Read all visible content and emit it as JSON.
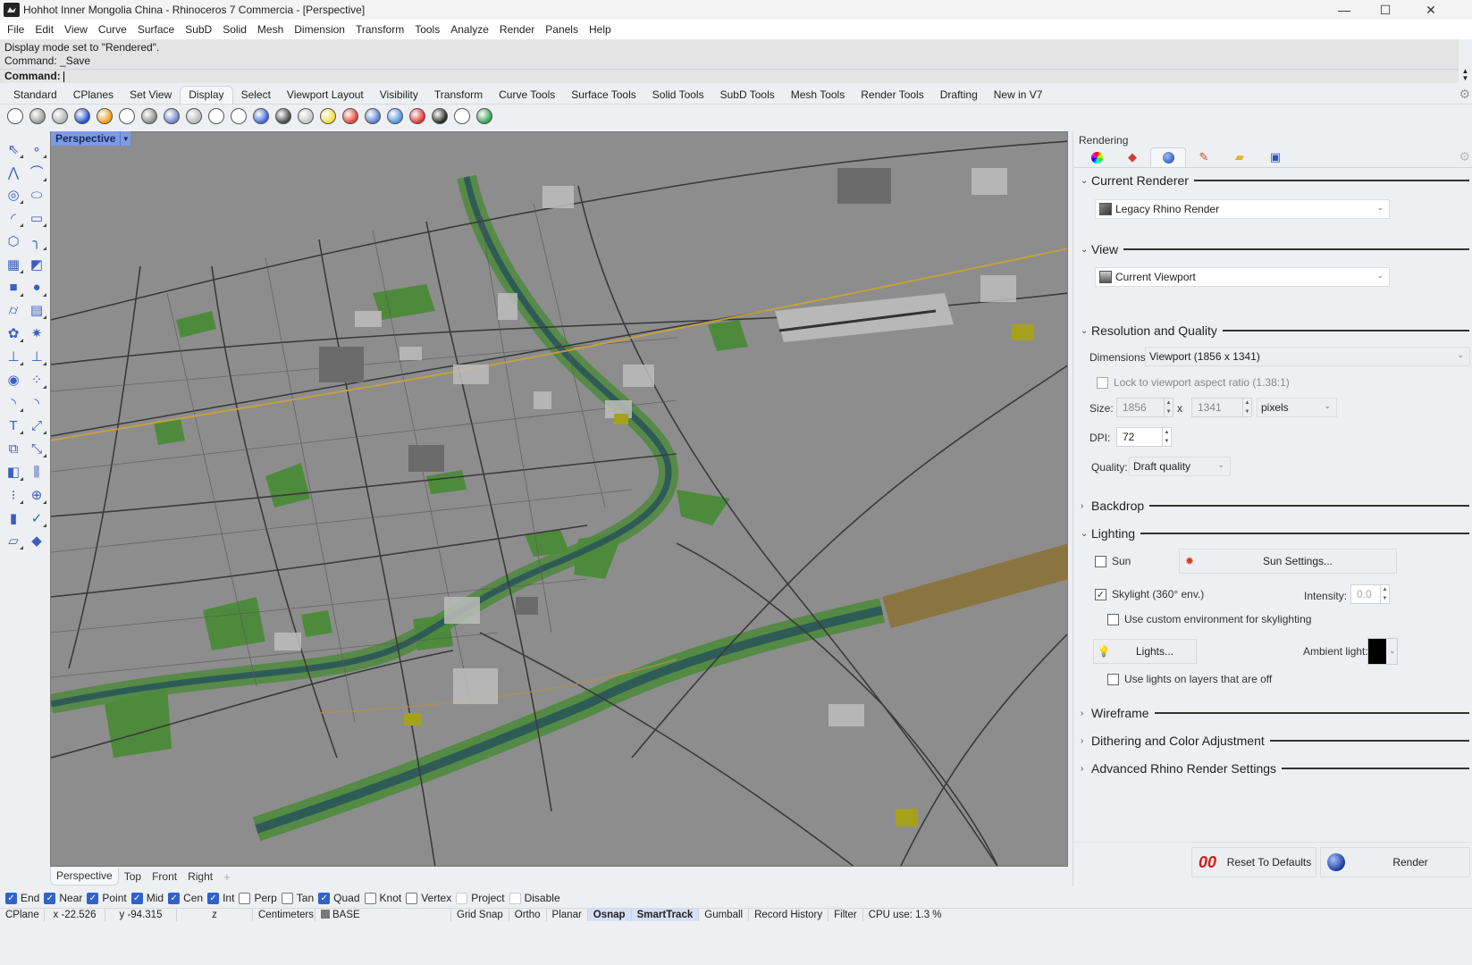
{
  "window": {
    "title": "Hohhot Inner Mongolia China - Rhinoceros 7 Commercia - [Perspective]",
    "controls": {
      "minimize": "—",
      "maximize": "☐",
      "close": "✕"
    }
  },
  "menu": [
    "File",
    "Edit",
    "View",
    "Curve",
    "Surface",
    "SubD",
    "Solid",
    "Mesh",
    "Dimension",
    "Transform",
    "Tools",
    "Analyze",
    "Render",
    "Panels",
    "Help"
  ],
  "command": {
    "history": [
      "Display mode set to \"Rendered\".",
      "Command: _Save"
    ],
    "prompt": "Command:",
    "value": ""
  },
  "toolbar_tabs": {
    "items": [
      "Standard",
      "CPlanes",
      "Set View",
      "Display",
      "Select",
      "Viewport Layout",
      "Visibility",
      "Transform",
      "Curve Tools",
      "Surface Tools",
      "Solid Tools",
      "SubD Tools",
      "Mesh Tools",
      "Render Tools",
      "Drafting",
      "New in V7"
    ],
    "active": "Display"
  },
  "display_icons": [
    {
      "name": "wireframe-icon",
      "color": "#ffffff"
    },
    {
      "name": "shaded-icon",
      "color": "#9a9a9a"
    },
    {
      "name": "rendered-icon",
      "color": "#b0b0b0"
    },
    {
      "name": "ghosted-icon",
      "color": "#1f4fd0"
    },
    {
      "name": "xray-icon",
      "color": "#f39a12"
    },
    {
      "name": "technical-icon",
      "color": "#ffffff"
    },
    {
      "name": "artistic-icon",
      "color": "#8a8a8a"
    },
    {
      "name": "pen-icon",
      "color": "#6d83c8"
    },
    {
      "name": "arctic-icon",
      "color": "#b8b8b8"
    },
    {
      "name": "monochrome-icon",
      "color": "#ffffff"
    },
    {
      "name": "raytraced-icon",
      "color": "#ffffff"
    },
    {
      "name": "show-edges-icon",
      "color": "#3a66d8"
    },
    {
      "name": "show-mesh-icon",
      "color": "#444444"
    },
    {
      "name": "isocurves-icon",
      "color": "#c4c4c4"
    },
    {
      "name": "lights-icon",
      "color": "#f0dc3a"
    },
    {
      "name": "cplane-icon",
      "color": "#e04030"
    },
    {
      "name": "camera-icon",
      "color": "#5a7ad0"
    },
    {
      "name": "screen-icon",
      "color": "#5090e0"
    },
    {
      "name": "hide-icon",
      "color": "#e03030"
    },
    {
      "name": "monitor-icon",
      "color": "#222222"
    },
    {
      "name": "boxes-icon",
      "color": "#ffffff"
    },
    {
      "name": "color-cube-icon",
      "color": "#30a050"
    }
  ],
  "left_tools": [
    "select-arrow-icon",
    "point-icon",
    "polyline-icon",
    "curve-icon",
    "circle-icon",
    "ellipse-icon",
    "arc-icon",
    "rectangle-icon",
    "polygon-icon",
    "fillet-curve-icon",
    "surface-from-points-icon",
    "extrude-surface-icon",
    "box-icon",
    "sphere-icon",
    "cylinder-icon",
    "mesh-surface-icon",
    "boolean-icon",
    "explode-icon",
    "trim-icon",
    "split-icon",
    "group-icon",
    "points-on-icon",
    "fillet-icon",
    "chamfer-icon",
    "text-icon",
    "dimension-icon",
    "block-icon",
    "scale-icon",
    "solid-edit-icon",
    "extrude-icon",
    "array-icon",
    "gumball-icon",
    "analyze-icon",
    "check-icon",
    "mesh-icon",
    "render-icon"
  ],
  "left_tool_glyphs": [
    "⇖",
    "∘",
    "⋀",
    "⌒",
    "◎",
    "⬭",
    "◜",
    "▭",
    "⬡",
    "╮",
    "▦",
    "◩",
    "■",
    "●",
    "⌭",
    "▤",
    "✿",
    "✷",
    "⊥",
    "⊥",
    "◉",
    "⁘",
    "◝",
    "◝",
    "T",
    "⤢",
    "⧉",
    "⤡",
    "◧",
    "⫼",
    "⁝",
    "⊕",
    "▮",
    "✓",
    "▱",
    "◆"
  ],
  "viewport": {
    "label": "Perspective",
    "tabs": [
      "Perspective",
      "Top",
      "Front",
      "Right"
    ],
    "active_tab": "Perspective",
    "add_tab_icon": "+"
  },
  "osnaps": [
    {
      "label": "End",
      "checked": true
    },
    {
      "label": "Near",
      "checked": true
    },
    {
      "label": "Point",
      "checked": true
    },
    {
      "label": "Mid",
      "checked": true
    },
    {
      "label": "Cen",
      "checked": true
    },
    {
      "label": "Int",
      "checked": true
    },
    {
      "label": "Perp",
      "checked": false
    },
    {
      "label": "Tan",
      "checked": false
    },
    {
      "label": "Quad",
      "checked": true
    },
    {
      "label": "Knot",
      "checked": false
    },
    {
      "label": "Vertex",
      "checked": false
    },
    {
      "label": "Project",
      "checked": false
    },
    {
      "label": "Disable",
      "checked": false
    }
  ],
  "status": {
    "cplane": "CPlane",
    "x": "x -22.526",
    "y": "y -94.315",
    "z": "z",
    "units": "Centimeters",
    "layer": "BASE",
    "toggles": [
      {
        "label": "Grid Snap",
        "active": false
      },
      {
        "label": "Ortho",
        "active": false
      },
      {
        "label": "Planar",
        "active": false
      },
      {
        "label": "Osnap",
        "active": true
      },
      {
        "label": "SmartTrack",
        "active": true
      },
      {
        "label": "Gumball",
        "active": false
      },
      {
        "label": "Record History",
        "active": false
      },
      {
        "label": "Filter",
        "active": false
      }
    ],
    "cpu": "CPU use: 1.3 %"
  },
  "panel": {
    "title": "Rendering",
    "tabs": [
      "color-wheel-icon",
      "material-icon",
      "render-settings-icon",
      "sun-tool-icon",
      "folder-icon",
      "help-icon"
    ],
    "active_tab": 2,
    "sections": {
      "current_renderer": {
        "label": "Current Renderer",
        "expanded": true,
        "value": "Legacy Rhino Render"
      },
      "view": {
        "label": "View",
        "expanded": true,
        "value": "Current Viewport"
      },
      "resolution": {
        "label": "Resolution and Quality",
        "expanded": true,
        "dimensions_label": "Dimensions:",
        "dimensions_value": "Viewport (1856 x 1341)",
        "lock_label": "Lock to viewport aspect ratio (1.38:1)",
        "lock_checked": false,
        "size_label": "Size:",
        "width": "1856",
        "x_label": "x",
        "height": "1341",
        "units": "pixels",
        "dpi_label": "DPI:",
        "dpi": "72",
        "quality_label": "Quality:",
        "quality": "Draft quality"
      },
      "backdrop": {
        "label": "Backdrop",
        "expanded": false
      },
      "lighting": {
        "label": "Lighting",
        "expanded": true,
        "sun_label": "Sun",
        "sun_checked": false,
        "sun_settings": "Sun Settings...",
        "skylight_label": "Skylight (360° env.)",
        "skylight_checked": true,
        "intensity_label": "Intensity:",
        "intensity": "0.0",
        "custom_env_label": "Use custom environment for skylighting",
        "custom_env_checked": false,
        "lights_button": "Lights...",
        "ambient_label": "Ambient light:",
        "ambient_color": "#000000",
        "lights_off_label": "Use lights on layers that are off",
        "lights_off_checked": false
      },
      "wireframe": {
        "label": "Wireframe",
        "expanded": false
      },
      "dithering": {
        "label": "Dithering and Color Adjustment",
        "expanded": false
      },
      "advanced": {
        "label": "Advanced Rhino Render Settings",
        "expanded": false
      }
    },
    "reset_button": "Reset To Defaults",
    "render_button": "Render"
  },
  "colors": {
    "viewport_bg": "#8d8d8d",
    "park_green": "#4e8a3c",
    "river": "#2f5b57",
    "road": "#3c3c3c",
    "highway": "#c9a33a",
    "accent_blue": "#2e64c9"
  }
}
